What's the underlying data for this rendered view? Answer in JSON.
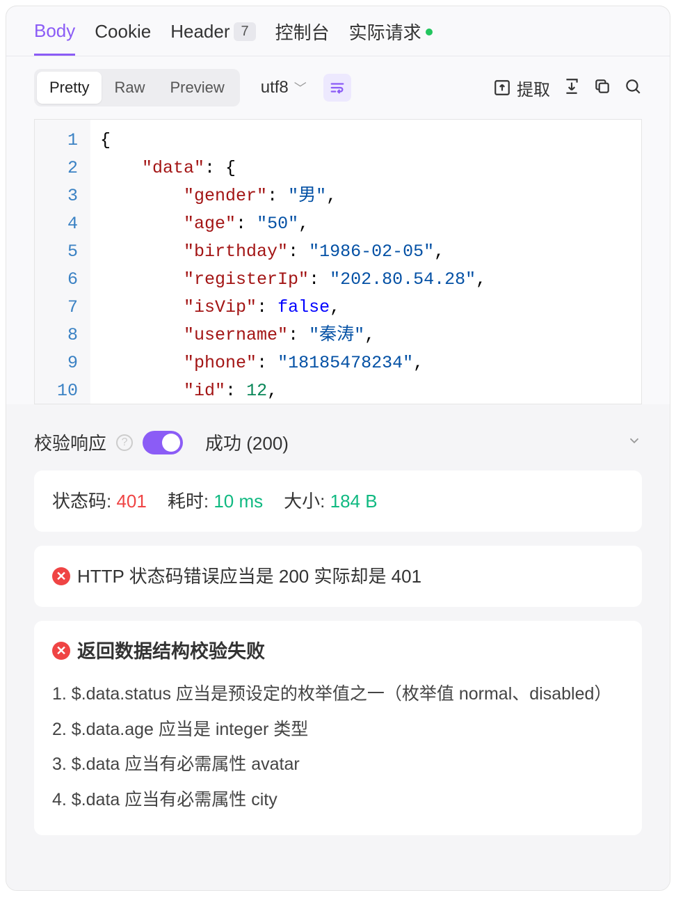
{
  "tabs": {
    "body": "Body",
    "cookie": "Cookie",
    "header": "Header",
    "header_badge": "7",
    "console": "控制台",
    "actual": "实际请求"
  },
  "toolbar": {
    "pretty": "Pretty",
    "raw": "Raw",
    "preview": "Preview",
    "encoding": "utf8",
    "extract": "提取"
  },
  "code": {
    "lines": [
      "1",
      "2",
      "3",
      "4",
      "5",
      "6",
      "7",
      "8",
      "9",
      "10"
    ],
    "json": {
      "data_key": "\"data\"",
      "gender_key": "\"gender\"",
      "gender_val": "\"男\"",
      "age_key": "\"age\"",
      "age_val": "\"50\"",
      "birthday_key": "\"birthday\"",
      "birthday_val": "\"1986-02-05\"",
      "registerIp_key": "\"registerIp\"",
      "registerIp_val": "\"202.80.54.28\"",
      "isVip_key": "\"isVip\"",
      "isVip_val": "false",
      "username_key": "\"username\"",
      "username_val": "\"秦涛\"",
      "phone_key": "\"phone\"",
      "phone_val": "\"18185478234\"",
      "id_key": "\"id\"",
      "id_val": "12"
    }
  },
  "validation": {
    "title": "校验响应",
    "status_label": "成功 (200)",
    "stats": {
      "code_label": "状态码:",
      "code_value": "401",
      "time_label": "耗时:",
      "time_value": "10 ms",
      "size_label": "大小:",
      "size_value": "184 B"
    },
    "error1": "HTTP 状态码错误应当是 200 实际却是 401",
    "error2_title": "返回数据结构校验失败",
    "error2_items": [
      "1. $.data.status 应当是预设定的枚举值之一（枚举值 normal、disabled）",
      "2. $.data.age 应当是 integer 类型",
      "3. $.data 应当有必需属性 avatar",
      "4. $.data 应当有必需属性 city"
    ]
  }
}
